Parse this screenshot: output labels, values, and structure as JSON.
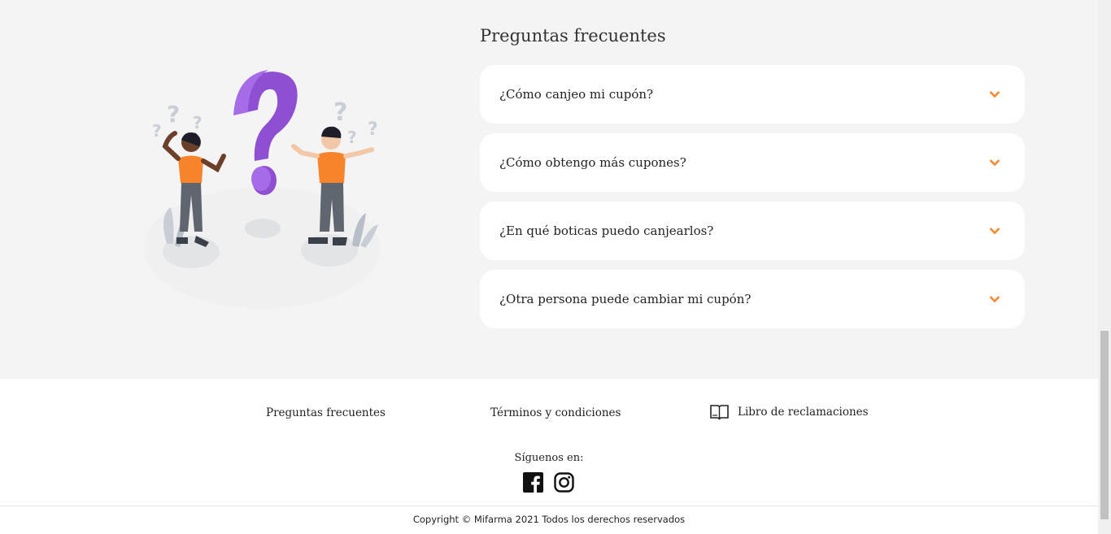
{
  "faq": {
    "title": "Preguntas frecuentes",
    "items": [
      {
        "question": "¿Cómo canjeo mi cupón?"
      },
      {
        "question": "¿Cómo obtengo más cupones?"
      },
      {
        "question": "¿En qué boticas puedo canjearlos?"
      },
      {
        "question": "¿Otra persona puede cambiar mi cupón?"
      }
    ],
    "accent_color": "#f7832b"
  },
  "footer": {
    "links": {
      "faq": "Preguntas frecuentes",
      "terms": "Términos y condiciones",
      "complaints": "Libro de reclamaciones"
    },
    "follow_label": "Síguenos en:",
    "social": [
      "facebook-icon",
      "instagram-icon"
    ],
    "copyright": "Copyright © Mifarma 2021 Todos los derechos reservados"
  }
}
